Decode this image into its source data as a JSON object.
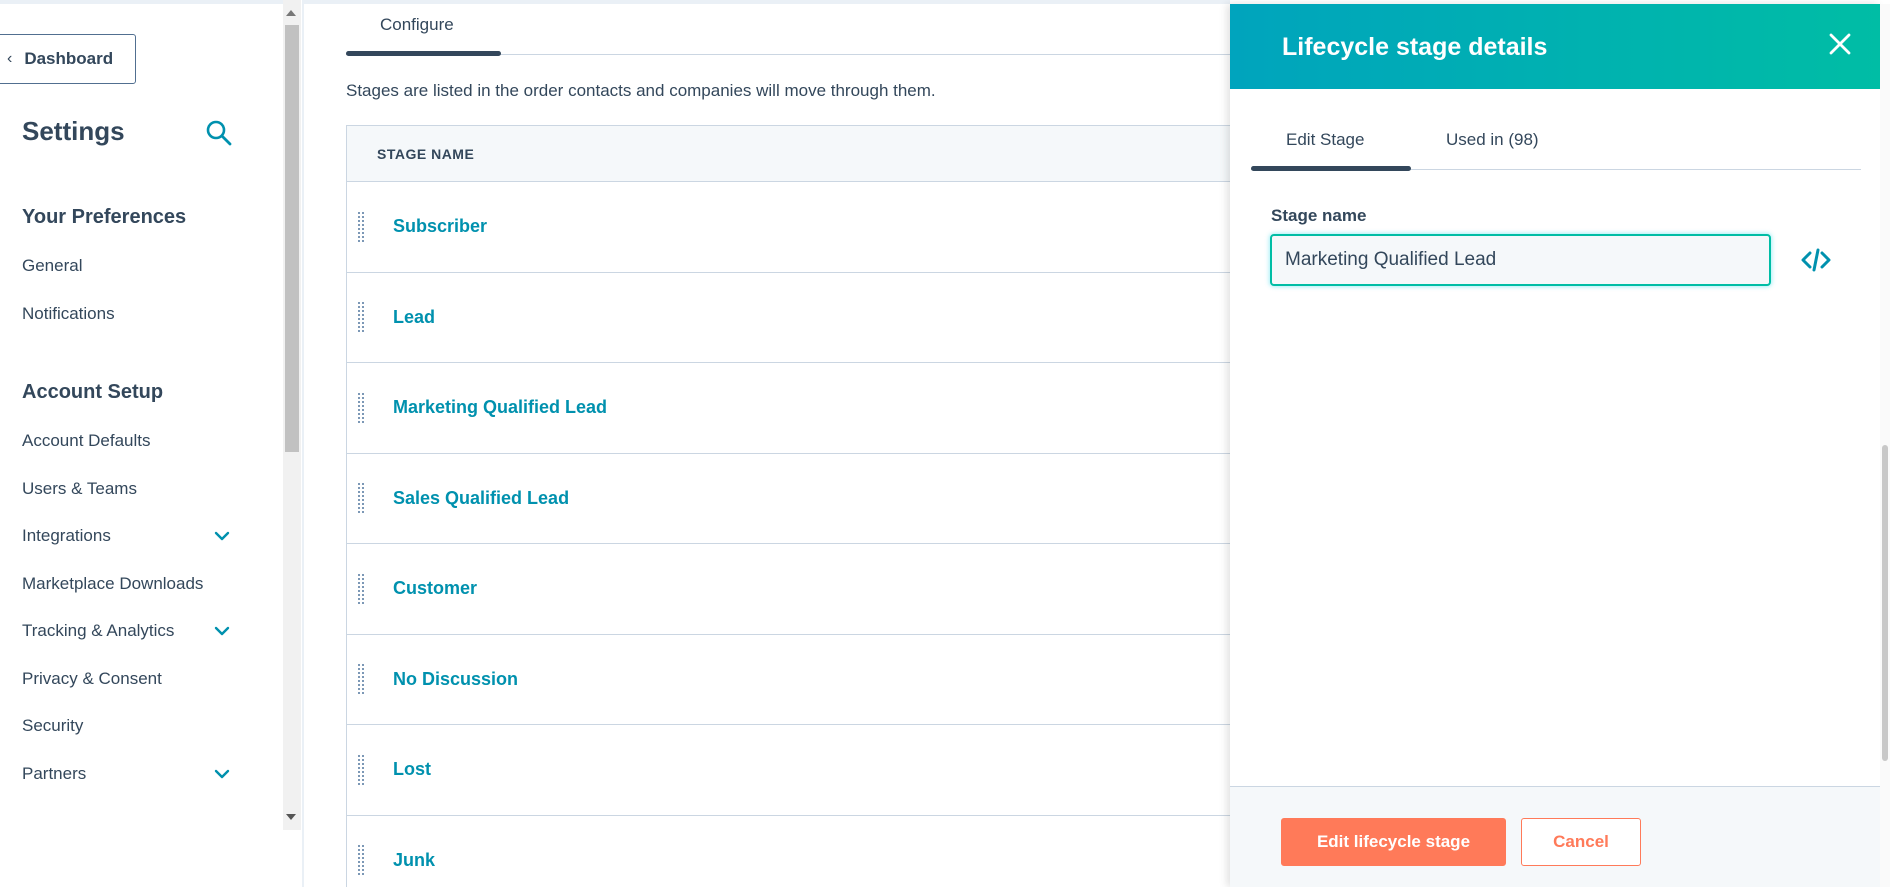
{
  "sidebar": {
    "back_button_label": "Dashboard",
    "title": "Settings",
    "sections": [
      {
        "title": "Your Preferences",
        "items": [
          {
            "label": "General",
            "expandable": false
          },
          {
            "label": "Notifications",
            "expandable": false
          }
        ]
      },
      {
        "title": "Account Setup",
        "items": [
          {
            "label": "Account Defaults",
            "expandable": false
          },
          {
            "label": "Users & Teams",
            "expandable": false
          },
          {
            "label": "Integrations",
            "expandable": true
          },
          {
            "label": "Marketplace Downloads",
            "expandable": false
          },
          {
            "label": "Tracking & Analytics",
            "expandable": true
          },
          {
            "label": "Privacy & Consent",
            "expandable": false
          },
          {
            "label": "Security",
            "expandable": false
          },
          {
            "label": "Partners",
            "expandable": true
          }
        ]
      }
    ],
    "icons": {
      "search": "search-icon",
      "back": "chevron-left-icon",
      "expand": "chevron-down-icon"
    }
  },
  "main": {
    "active_tab": "Configure",
    "description": "Stages are listed in the order contacts and companies will move through them.",
    "table": {
      "column_header": "STAGE NAME",
      "rows": [
        "Subscriber",
        "Lead",
        "Marketing Qualified Lead",
        "Sales Qualified Lead",
        "Customer",
        "No Discussion",
        "Lost",
        "Junk"
      ]
    }
  },
  "panel": {
    "title": "Lifecycle stage details",
    "tabs": [
      {
        "label": "Edit Stage",
        "active": true
      },
      {
        "label": "Used in (98)",
        "active": false
      }
    ],
    "field_label": "Stage name",
    "field_value": "Marketing Qualified Lead",
    "primary_button": "Edit lifecycle stage",
    "secondary_button": "Cancel",
    "icons": {
      "close": "close-icon",
      "code": "code-icon"
    }
  },
  "colors": {
    "text": "#33475b",
    "link": "#0091ae",
    "header_gradient_start": "#00a4bd",
    "header_gradient_end": "#00bda5",
    "primary": "#ff7a59",
    "border": "#cbd6e2",
    "surface": "#f5f8fa"
  }
}
